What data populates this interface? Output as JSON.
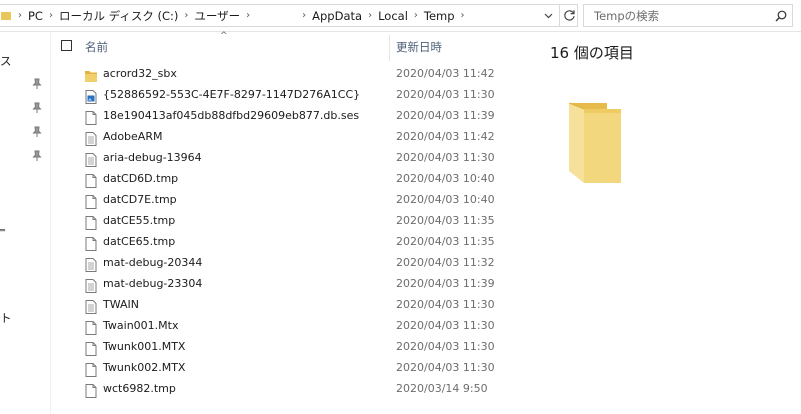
{
  "address": {
    "crumbs": [
      "PC",
      "ローカル ディスク (C:)",
      "ユーザー",
      "",
      "AppData",
      "Local",
      "Temp"
    ]
  },
  "search": {
    "placeholder": "Tempの検索"
  },
  "nav": {
    "fragments": [
      "ス",
      "‗",
      "ト"
    ]
  },
  "columns": {
    "name": "名前",
    "date": "更新日時"
  },
  "files": [
    {
      "name": "acrord32_sbx",
      "date": "2020/04/03 11:42",
      "icon": "folder-icon"
    },
    {
      "name": "{52886592-553C-4E7F-8297-1147D276A1CC}",
      "date": "2020/04/03 11:30",
      "icon": "image-file-icon"
    },
    {
      "name": "18e190413af045db88dfbd29609eb877.db.ses",
      "date": "2020/04/03 11:39",
      "icon": "file-icon"
    },
    {
      "name": "AdobeARM",
      "date": "2020/04/03 11:42",
      "icon": "text-file-icon"
    },
    {
      "name": "aria-debug-13964",
      "date": "2020/04/03 11:30",
      "icon": "text-file-icon"
    },
    {
      "name": "datCD6D.tmp",
      "date": "2020/04/03 10:40",
      "icon": "file-icon"
    },
    {
      "name": "datCD7E.tmp",
      "date": "2020/04/03 10:40",
      "icon": "file-icon"
    },
    {
      "name": "datCE55.tmp",
      "date": "2020/04/03 11:35",
      "icon": "file-icon"
    },
    {
      "name": "datCE65.tmp",
      "date": "2020/04/03 11:35",
      "icon": "file-icon"
    },
    {
      "name": "mat-debug-20344",
      "date": "2020/04/03 11:32",
      "icon": "text-file-icon"
    },
    {
      "name": "mat-debug-23304",
      "date": "2020/04/03 11:39",
      "icon": "text-file-icon"
    },
    {
      "name": "TWAIN",
      "date": "2020/04/03 11:30",
      "icon": "text-file-icon"
    },
    {
      "name": "Twain001.Mtx",
      "date": "2020/04/03 11:30",
      "icon": "file-icon"
    },
    {
      "name": "Twunk001.MTX",
      "date": "2020/04/03 11:30",
      "icon": "file-icon"
    },
    {
      "name": "Twunk002.MTX",
      "date": "2020/04/03 11:30",
      "icon": "file-icon"
    },
    {
      "name": "wct6982.tmp",
      "date": "2020/03/14 9:50",
      "icon": "file-icon"
    }
  ],
  "preview": {
    "count_text": "16 個の項目"
  },
  "colors": {
    "folder": "#e9c65a",
    "folder_dark": "#d9ad3c",
    "header_text": "#4c607a",
    "date_text": "#6d6d6d"
  }
}
